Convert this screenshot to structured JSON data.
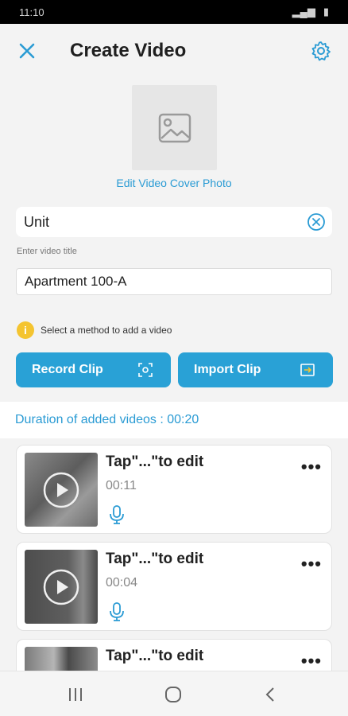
{
  "status_bar": {
    "time": "11:10"
  },
  "header": {
    "title": "Create Video",
    "close_icon": "close-icon",
    "settings_icon": "gear-icon"
  },
  "cover": {
    "link_label": "Edit Video Cover Photo",
    "icon": "image-placeholder-icon"
  },
  "unit_field": {
    "value": "Unit"
  },
  "title_field": {
    "label": "Enter video title",
    "value": "Apartment 100-A"
  },
  "info": {
    "text": "Select a method to add a video"
  },
  "buttons": {
    "record": "Record Clip",
    "import": "Import Clip"
  },
  "duration": {
    "text": "Duration of added videos : 00:20"
  },
  "clips": [
    {
      "title": "Tap\"...\"to edit",
      "duration": "00:11"
    },
    {
      "title": "Tap\"...\"to edit",
      "duration": "00:04"
    },
    {
      "title": "Tap\"...\"to edit",
      "duration": ""
    }
  ],
  "colors": {
    "accent": "#29a1d6",
    "info": "#f4c430",
    "background": "#f3f3f3"
  }
}
